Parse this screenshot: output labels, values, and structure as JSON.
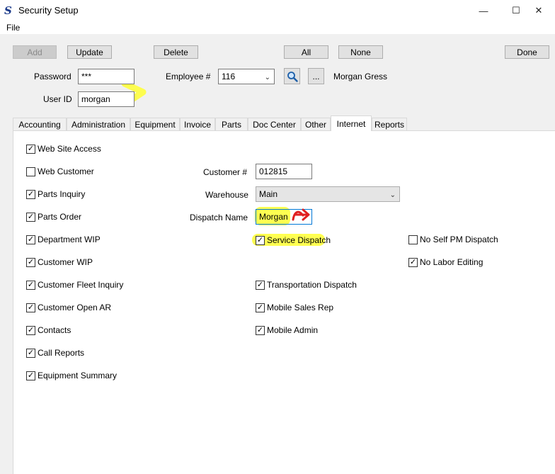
{
  "window": {
    "title": "Security Setup",
    "minimize": "—",
    "maximize": "☐",
    "close": "✕"
  },
  "menu": {
    "file": "File"
  },
  "toolbar": {
    "add": "Add",
    "update": "Update",
    "delete": "Delete",
    "all": "All",
    "none": "None",
    "done": "Done"
  },
  "header": {
    "password_label": "Password",
    "password_value": "***",
    "userid_label": "User ID",
    "userid_value": "morgan",
    "employee_label": "Employee #",
    "employee_value": "116",
    "lookup_more": "...",
    "employee_name": "Morgan Gress"
  },
  "tabs": [
    "Accounting",
    "Administration",
    "Equipment",
    "Invoice",
    "Parts",
    "Doc Center",
    "Other",
    "Internet",
    "Reports"
  ],
  "active_tab": "Internet",
  "internet": {
    "left_checks": [
      {
        "label": "Web Site Access",
        "checked": true
      },
      {
        "label": "Web Customer",
        "checked": false
      },
      {
        "label": "Parts Inquiry",
        "checked": true
      },
      {
        "label": "Parts Order",
        "checked": true
      },
      {
        "label": "Department WIP",
        "checked": true
      },
      {
        "label": "Customer WIP",
        "checked": true
      },
      {
        "label": "Customer Fleet Inquiry",
        "checked": true
      },
      {
        "label": "Customer Open AR",
        "checked": true
      },
      {
        "label": "Contacts",
        "checked": true
      },
      {
        "label": "Call Reports",
        "checked": true
      },
      {
        "label": "Equipment Summary",
        "checked": true
      }
    ],
    "customer_label": "Customer #",
    "customer_value": "012815",
    "warehouse_label": "Warehouse",
    "warehouse_value": "Main",
    "dispatch_label": "Dispatch Name",
    "dispatch_value": "Morgan",
    "mid_checks": [
      {
        "label": "Service Dispatch",
        "checked": true
      },
      {
        "label": "Transportation Dispatch",
        "checked": true
      },
      {
        "label": "Mobile Sales Rep",
        "checked": true
      },
      {
        "label": "Mobile Admin",
        "checked": true
      }
    ],
    "right_checks": [
      {
        "label": "No Self PM Dispatch",
        "checked": false
      },
      {
        "label": "No Labor Editing",
        "checked": true
      }
    ]
  },
  "icons": {
    "search": "search-icon",
    "chevron": "chevron-down-icon",
    "app": "app-logo-icon"
  },
  "colors": {
    "highlight": "#ffff33",
    "annotation_arrow": "#e02020",
    "focus_border": "#0078d7"
  }
}
